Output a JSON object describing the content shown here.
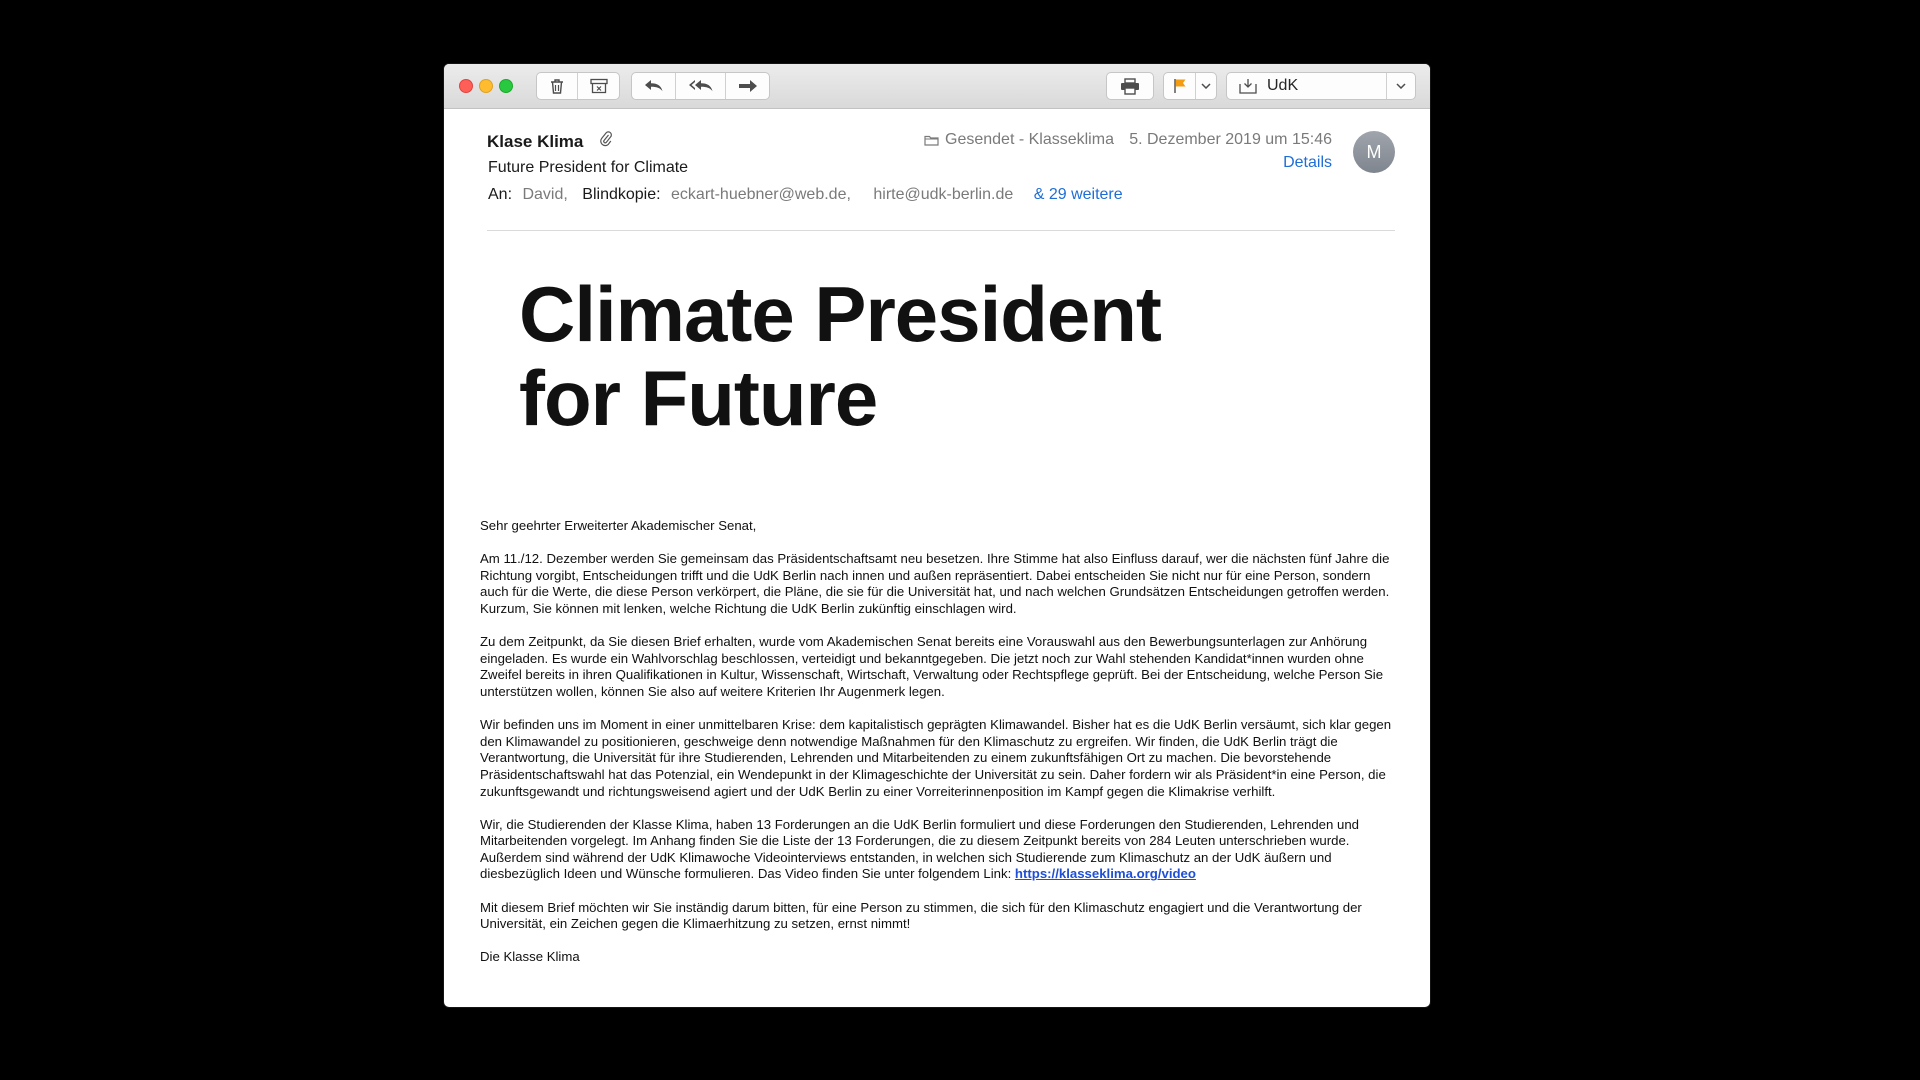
{
  "window": {
    "mailbox_select_label": "UdK"
  },
  "header": {
    "sender": "Klase Klima",
    "mailbox_label": "Gesendet - Klasseklima",
    "date": "5. Dezember 2019 um 15:46",
    "details_link": "Details",
    "avatar_initial": "M",
    "subject": "Future President for Climate",
    "to_label": "An:",
    "to_value": "David,",
    "bcc_label": "Blindkopie:",
    "bcc_1": "eckart-huebner@web.de,",
    "bcc_2": "hirte@udk-berlin.de",
    "more_recipients": "& 29 weitere"
  },
  "hero": {
    "line1": "Climate President",
    "line2": "for Future"
  },
  "body": {
    "greeting": "Sehr geehrter Erweiterter Akademischer Senat,",
    "p1": "Am 11./12. Dezember werden Sie gemeinsam das Präsidentschaftsamt neu besetzen. Ihre Stimme hat also Einfluss darauf, wer die nächsten fünf Jahre die Richtung vorgibt, Entscheidungen trifft und die UdK Berlin nach innen und außen repräsentiert. Dabei entscheiden Sie nicht nur für eine Person, sondern auch für die Werte, die diese Person verkörpert, die Pläne, die sie für die Universität hat, und nach welchen Grundsätzen Entscheidungen getroffen werden. Kurzum, Sie können mit lenken, welche Richtung die UdK Berlin zukünftig einschlagen wird.",
    "p2": "Zu dem Zeitpunkt, da Sie diesen Brief erhalten, wurde vom Akademischen Senat bereits eine Vorauswahl aus den Bewerbungsunterlagen zur Anhörung eingeladen. Es wurde ein Wahlvorschlag beschlossen, verteidigt und bekanntgegeben. Die jetzt noch zur Wahl stehenden Kandidat*innen wurden ohne Zweifel bereits in ihren Qualifikationen in Kultur, Wissenschaft, Wirtschaft, Verwaltung oder Rechtspflege geprüft. Bei der Entscheidung, welche Person Sie unterstützen wollen, können Sie also auf weitere Kriterien Ihr Augenmerk legen.",
    "p3": "Wir befinden uns im Moment in einer unmittelbaren Krise: dem kapitalistisch geprägten Klimawandel. Bisher hat es die UdK Berlin versäumt, sich klar gegen den Klimawandel zu positionieren, geschweige denn notwendige Maßnahmen für den Klimaschutz zu ergreifen. Wir finden, die UdK Berlin trägt die Verantwortung, die Universität für ihre Studierenden, Lehrenden und Mitarbeitenden zu einem zukunftsfähigen Ort zu machen. Die bevorstehende Präsidentschaftswahl hat das Potenzial, ein Wendepunkt in der Klimageschichte der Universität zu sein. Daher fordern wir als Präsident*in eine Person, die zukunftsgewandt und richtungsweisend agiert und der UdK Berlin zu einer Vorreiterinnenposition im Kampf gegen die Klimakrise verhilft.",
    "p4": "Wir, die Studierenden der Klasse Klima, haben 13 Forderungen an die UdK Berlin formuliert und diese Forderungen den Studierenden, Lehrenden und Mitarbeitenden vorgelegt. Im Anhang finden Sie die Liste der 13 Forderungen, die zu diesem Zeitpunkt bereits von 284 Leuten unterschrieben wurde. Außerdem sind während der UdK Klimawoche Videointerviews entstanden, in welchen sich Studierende zum Klimaschutz an der UdK äußern und diesbezüglich Ideen und Wünsche formulieren. Das Video finden Sie unter folgendem Link: ",
    "p4_link": "https://klasseklima.org/video",
    "p5": "Mit diesem Brief möchten wir Sie inständig darum bitten, für eine Person zu stimmen, die sich für den Klimaschutz engagiert und die Verantwortung der Universität, ein Zeichen gegen die Klimaerhitzung zu setzen, ernst nimmt!",
    "signature": "Die Klasse Klima"
  }
}
